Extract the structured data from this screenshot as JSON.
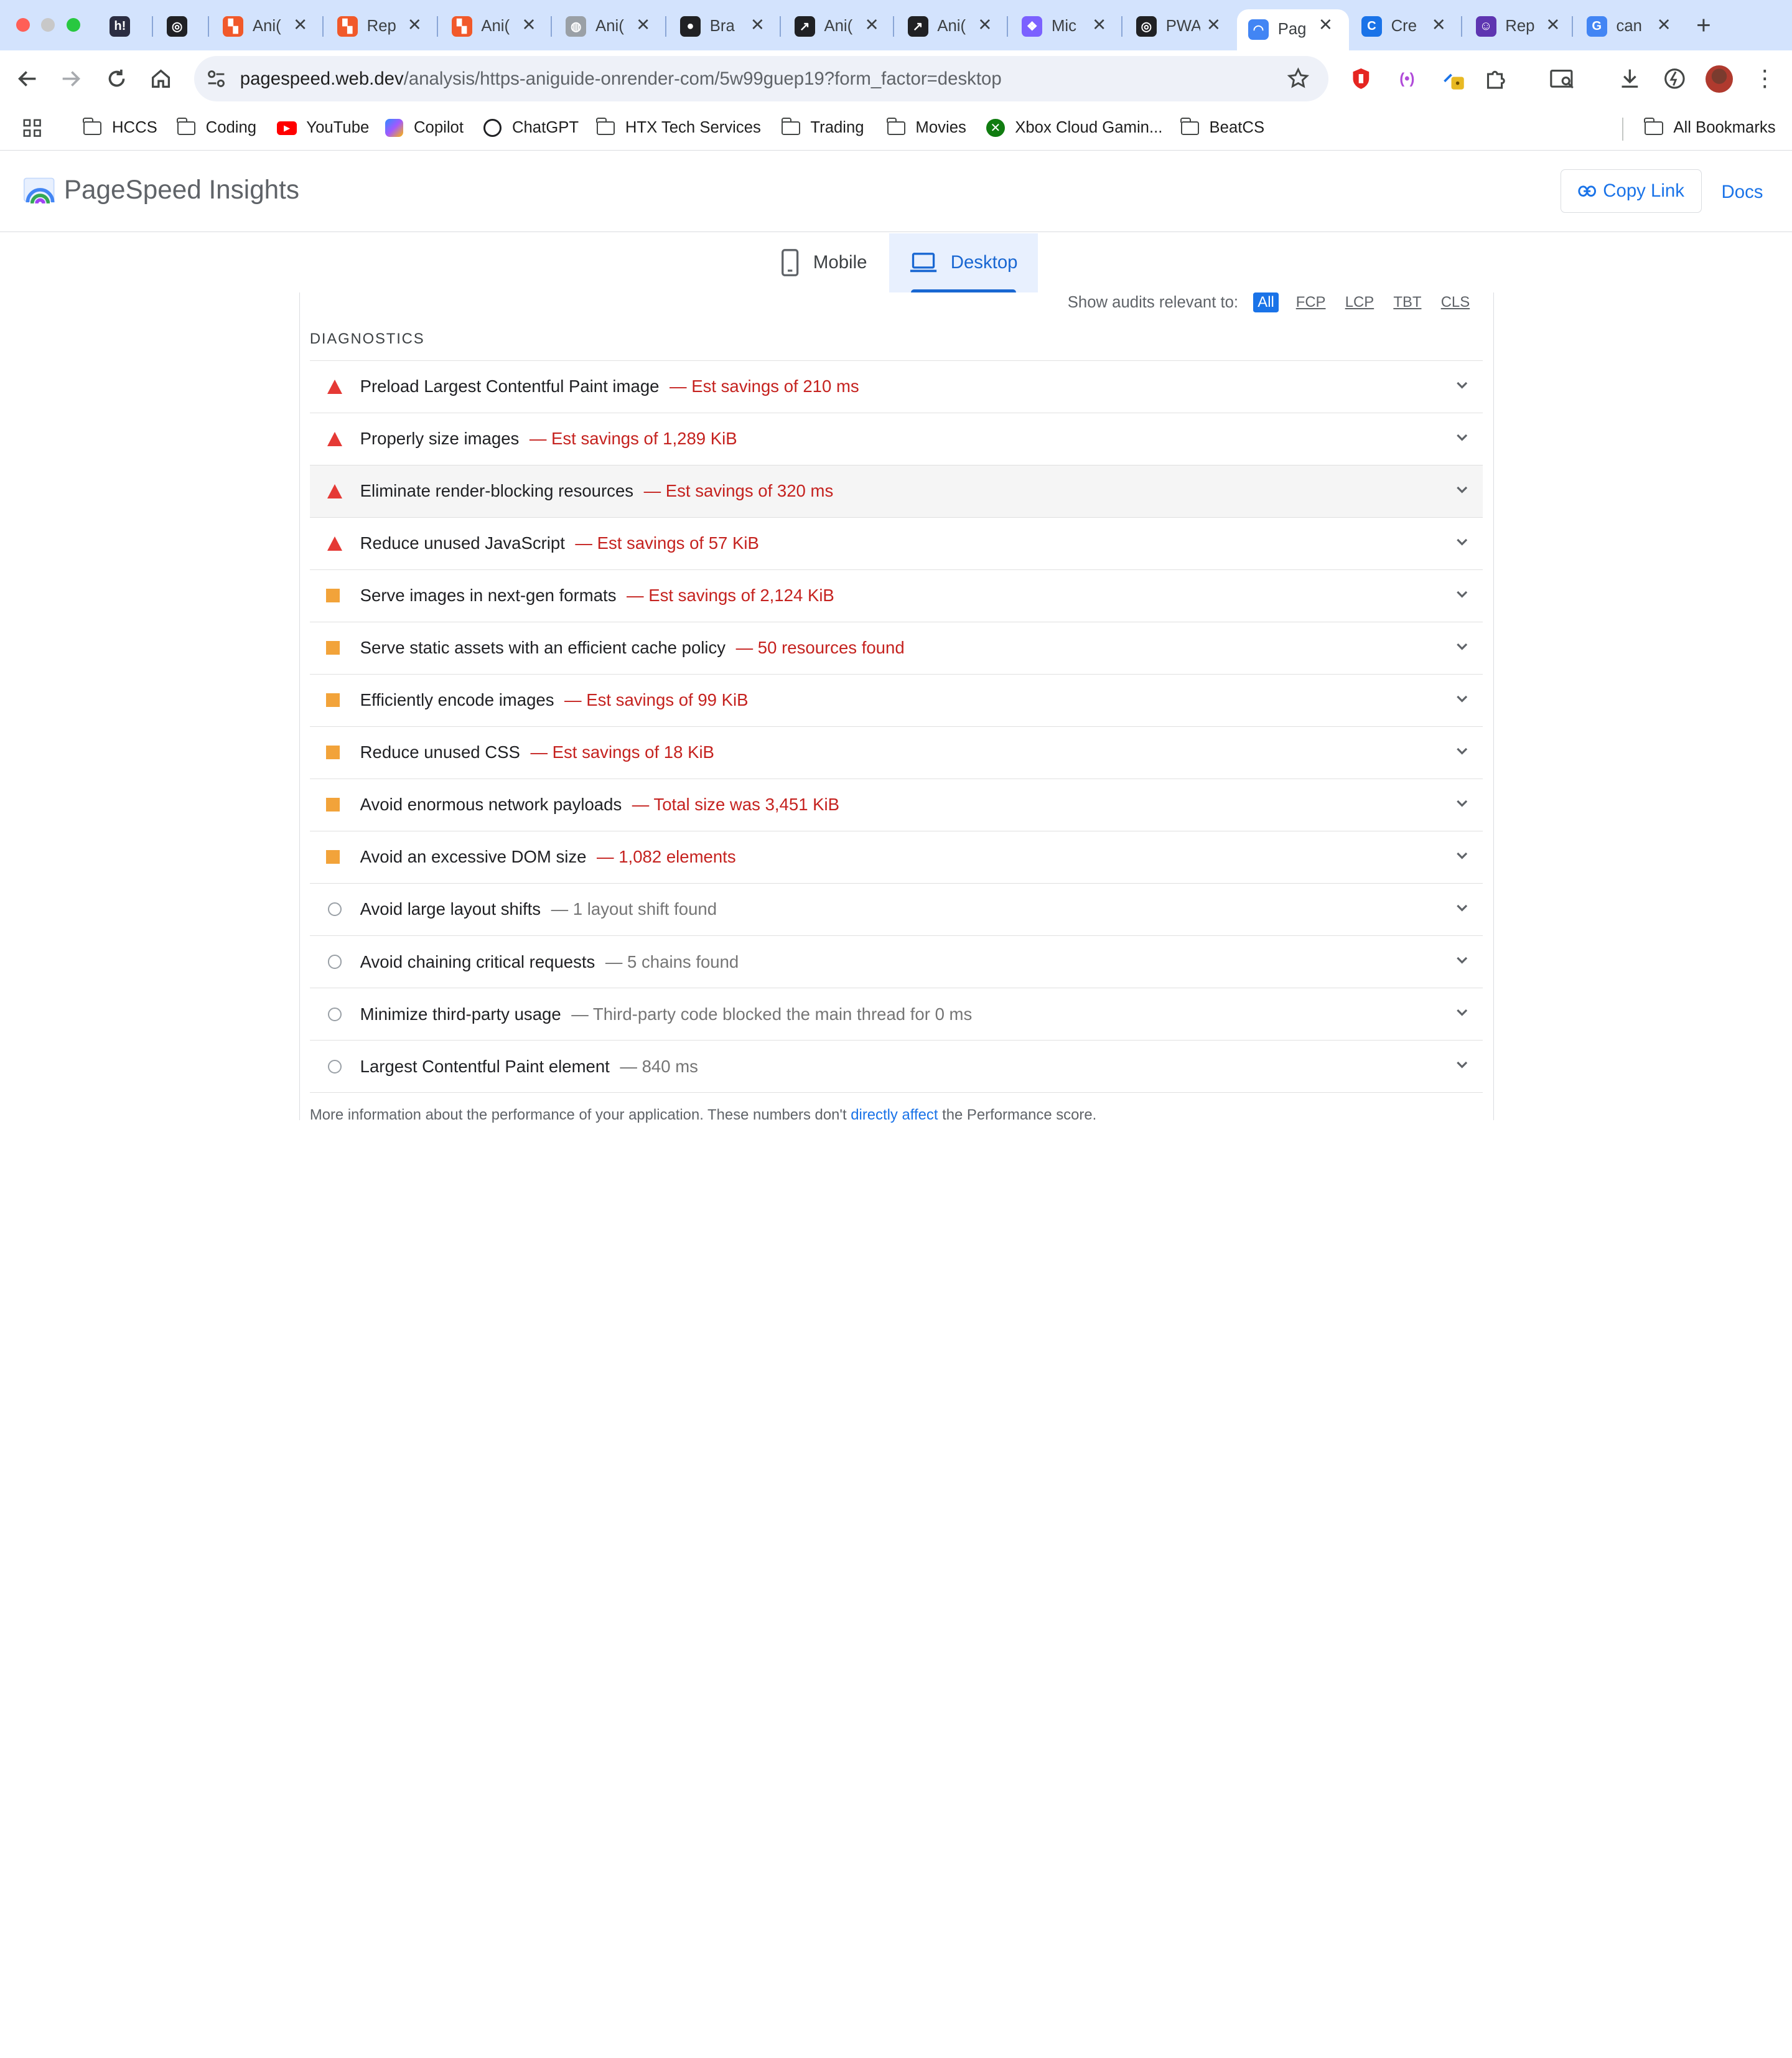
{
  "browser": {
    "tabs": [
      {
        "title": "",
        "icon": "hbo-h-icon",
        "color": "#2b2d42",
        "glyph": "h!"
      },
      {
        "title": "",
        "icon": "chatgpt-icon",
        "color": "#202124",
        "glyph": "◎"
      },
      {
        "title": "Ani(",
        "icon": "render-icon",
        "color": "#f1592a",
        "glyph": "▚"
      },
      {
        "title": "Rep",
        "icon": "render-icon",
        "color": "#f1592a",
        "glyph": "▚"
      },
      {
        "title": "Ani(",
        "icon": "render-icon",
        "color": "#f1592a",
        "glyph": "▚"
      },
      {
        "title": "Ani(",
        "icon": "globe-icon",
        "color": "#9aa0a6",
        "glyph": "◍"
      },
      {
        "title": "Bra",
        "icon": "github-icon",
        "color": "#202124",
        "glyph": "●"
      },
      {
        "title": "Ani(",
        "icon": "v0-icon",
        "color": "#202124",
        "glyph": "↗"
      },
      {
        "title": "Ani(",
        "icon": "v0-icon",
        "color": "#202124",
        "glyph": "↗"
      },
      {
        "title": "Mic",
        "icon": "copilot-icon",
        "color": "#7b61ff",
        "glyph": "❖"
      },
      {
        "title": "PWA",
        "icon": "chatgpt-icon",
        "color": "#202124",
        "glyph": "◎"
      },
      {
        "title": "Pag",
        "icon": "pagespeed-icon",
        "color": "#4285f4",
        "glyph": "◠",
        "active": true
      },
      {
        "title": "Cre",
        "icon": "canva-icon",
        "color": "#1a73e8",
        "glyph": "C"
      },
      {
        "title": "Rep",
        "icon": "profile-icon",
        "color": "#5e35b1",
        "glyph": "☺"
      },
      {
        "title": "can",
        "icon": "google-icon",
        "color": "#4285f4",
        "glyph": "G"
      }
    ],
    "close_glyph": "✕",
    "newtab_glyph": "+",
    "url_host": "pagespeed.web.dev",
    "url_path": "/analysis/https-aniguide-onrender-com/5w99guep19?form_factor=desktop"
  },
  "bookmarks": {
    "items": [
      "HCCS",
      "Coding",
      "YouTube",
      "Copilot",
      "ChatGPT",
      "HTX Tech Services",
      "Trading",
      "Movies",
      "Xbox Cloud Gamin...",
      "BeatCS"
    ],
    "all": "All Bookmarks"
  },
  "app": {
    "title": "PageSpeed Insights",
    "copy_link": "Copy Link",
    "docs": "Docs"
  },
  "device_tabs": {
    "mobile": "Mobile",
    "desktop": "Desktop"
  },
  "filter": {
    "label": "Show audits relevant to:",
    "chips": [
      "All",
      "FCP",
      "LCP",
      "TBT",
      "CLS"
    ]
  },
  "diagnostics": {
    "heading": "DIAGNOSTICS",
    "audits": [
      {
        "title": "Preload Largest Contentful Paint image",
        "detail": "— Est savings of 210 ms",
        "severity": "fail"
      },
      {
        "title": "Properly size images",
        "detail": "— Est savings of 1,289 KiB",
        "severity": "fail"
      },
      {
        "title": "Eliminate render-blocking resources",
        "detail": "— Est savings of 320 ms",
        "severity": "fail"
      },
      {
        "title": "Reduce unused JavaScript",
        "detail": "— Est savings of 57 KiB",
        "severity": "fail"
      },
      {
        "title": "Serve images in next-gen formats",
        "detail": "— Est savings of 2,124 KiB",
        "severity": "average"
      },
      {
        "title": "Serve static assets with an efficient cache policy",
        "detail": "— 50 resources found",
        "severity": "average"
      },
      {
        "title": "Efficiently encode images",
        "detail": "— Est savings of 99 KiB",
        "severity": "average"
      },
      {
        "title": "Reduce unused CSS",
        "detail": "— Est savings of 18 KiB",
        "severity": "average"
      },
      {
        "title": "Avoid enormous network payloads",
        "detail": "— Total size was 3,451 KiB",
        "severity": "average"
      },
      {
        "title": "Avoid an excessive DOM size",
        "detail": "— 1,082 elements",
        "severity": "average"
      },
      {
        "title": "Avoid large layout shifts",
        "detail": "— 1 layout shift found",
        "severity": "info"
      },
      {
        "title": "Avoid chaining critical requests",
        "detail": "— 5 chains found",
        "severity": "info"
      },
      {
        "title": "Minimize third-party usage",
        "detail": "— Third-party code blocked the main thread for 0 ms",
        "severity": "info"
      },
      {
        "title": "Largest Contentful Paint element",
        "detail": "— 840 ms",
        "severity": "info"
      }
    ],
    "footer_before": "More information about the performance of your application. These numbers don't ",
    "footer_link": "directly affect",
    "footer_after": " the Performance score."
  },
  "colors": {
    "fail": "#e53935",
    "average": "#f2a33a",
    "info": "#9aa0a6",
    "accent": "#1a73e8"
  }
}
